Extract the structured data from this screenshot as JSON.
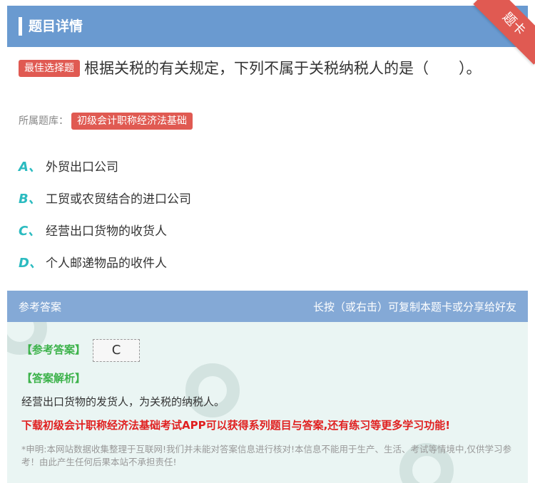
{
  "header": {
    "title": "题目详情",
    "ribbon": "题卡"
  },
  "question": {
    "type_tag": "最佳选择题",
    "text": "根据关税的有关规定，下列不属于关税纳税人的是（　　）。"
  },
  "bank": {
    "label": "所属题库：",
    "name": "初级会计职称经济法基础"
  },
  "options": [
    {
      "letter": "A、",
      "text": "外贸出口公司"
    },
    {
      "letter": "B、",
      "text": "工贸或农贸结合的进口公司"
    },
    {
      "letter": "C、",
      "text": "经营出口货物的收货人"
    },
    {
      "letter": "D、",
      "text": "个人邮递物品的收件人"
    }
  ],
  "answer_bar": {
    "left": "参考答案",
    "right": "长按（或右击）可复制本题卡或分享给好友"
  },
  "answer": {
    "ref_label": "【参考答案】",
    "ref_value": "C",
    "expl_label": "【答案解析】",
    "expl_text": "经营出口货物的发货人，为关税的纳税人。",
    "promo": "下载初级会计职称经济法基础考试APP可以获得系列题目与答案,还有练习等更多学习功能!",
    "disclaimer": "*申明:本网站数据收集整理于互联网!我们并未能对答案信息进行核对!本信息不能用于生产、生活、考试等情境中,仅供学习参考！由此产生任何后果本站不承担责任!"
  },
  "colors": {
    "header": "#6a9ad0",
    "tag": "#e05a52",
    "option_letter": "#2bbbc0",
    "answer_bg": "#eaf5f3",
    "promo": "#e02020"
  }
}
